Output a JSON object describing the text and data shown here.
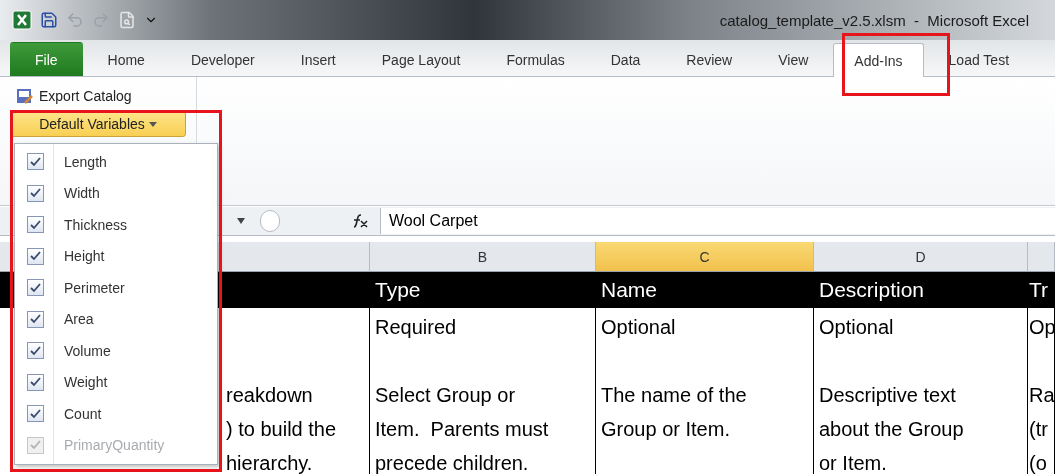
{
  "window": {
    "title": "catalog_template_v2.5.xlsm  -  Microsoft Excel"
  },
  "tabs": [
    {
      "label": "File",
      "kind": "file",
      "selected": false
    },
    {
      "label": "Home",
      "kind": "tab",
      "selected": false
    },
    {
      "label": "Developer",
      "kind": "tab",
      "selected": false
    },
    {
      "label": "Insert",
      "kind": "tab",
      "selected": false
    },
    {
      "label": "Page Layout",
      "kind": "tab",
      "selected": false
    },
    {
      "label": "Formulas",
      "kind": "tab",
      "selected": false
    },
    {
      "label": "Data",
      "kind": "tab",
      "selected": false
    },
    {
      "label": "Review",
      "kind": "tab",
      "selected": false
    },
    {
      "label": "View",
      "kind": "tab",
      "selected": false
    },
    {
      "label": "Add-Ins",
      "kind": "tab",
      "selected": true
    },
    {
      "label": "Load Test",
      "kind": "tab",
      "selected": false
    }
  ],
  "ribbon": {
    "export_button": "Export Catalog",
    "variables_button": "Default Variables"
  },
  "dropdown": {
    "items": [
      {
        "label": "Length",
        "checked": true,
        "disabled": false
      },
      {
        "label": "Width",
        "checked": true,
        "disabled": false
      },
      {
        "label": "Thickness",
        "checked": true,
        "disabled": false
      },
      {
        "label": "Height",
        "checked": true,
        "disabled": false
      },
      {
        "label": "Perimeter",
        "checked": true,
        "disabled": false
      },
      {
        "label": "Area",
        "checked": true,
        "disabled": false
      },
      {
        "label": "Volume",
        "checked": true,
        "disabled": false
      },
      {
        "label": "Weight",
        "checked": true,
        "disabled": false
      },
      {
        "label": "Count",
        "checked": true,
        "disabled": false
      },
      {
        "label": "PrimaryQuantity",
        "checked": true,
        "disabled": true
      }
    ]
  },
  "formula_bar": {
    "value": "Wool Carpet"
  },
  "sheet": {
    "columns": [
      {
        "kind": "covered",
        "lines": [
          "reakdown",
          ") to build the",
          "hierarchy."
        ]
      },
      {
        "kind": "normal",
        "letter": "B",
        "selected": false,
        "title": "Type",
        "requirement": "Required",
        "lines": [
          "Select Group or",
          "Item.  Parents must",
          "precede children."
        ]
      },
      {
        "kind": "normal",
        "letter": "C",
        "selected": true,
        "title": "Name",
        "requirement": "Optional",
        "lines": [
          "The name of the",
          "Group or Item."
        ]
      },
      {
        "kind": "normal",
        "letter": "D",
        "selected": false,
        "title": "Description",
        "requirement": "Optional",
        "lines": [
          "Descriptive text",
          "about the Group",
          "or Item."
        ]
      },
      {
        "kind": "edge",
        "title": "Tr",
        "requirement": "Op",
        "lines": [
          "Ra",
          "(tr",
          "(o"
        ]
      }
    ]
  }
}
